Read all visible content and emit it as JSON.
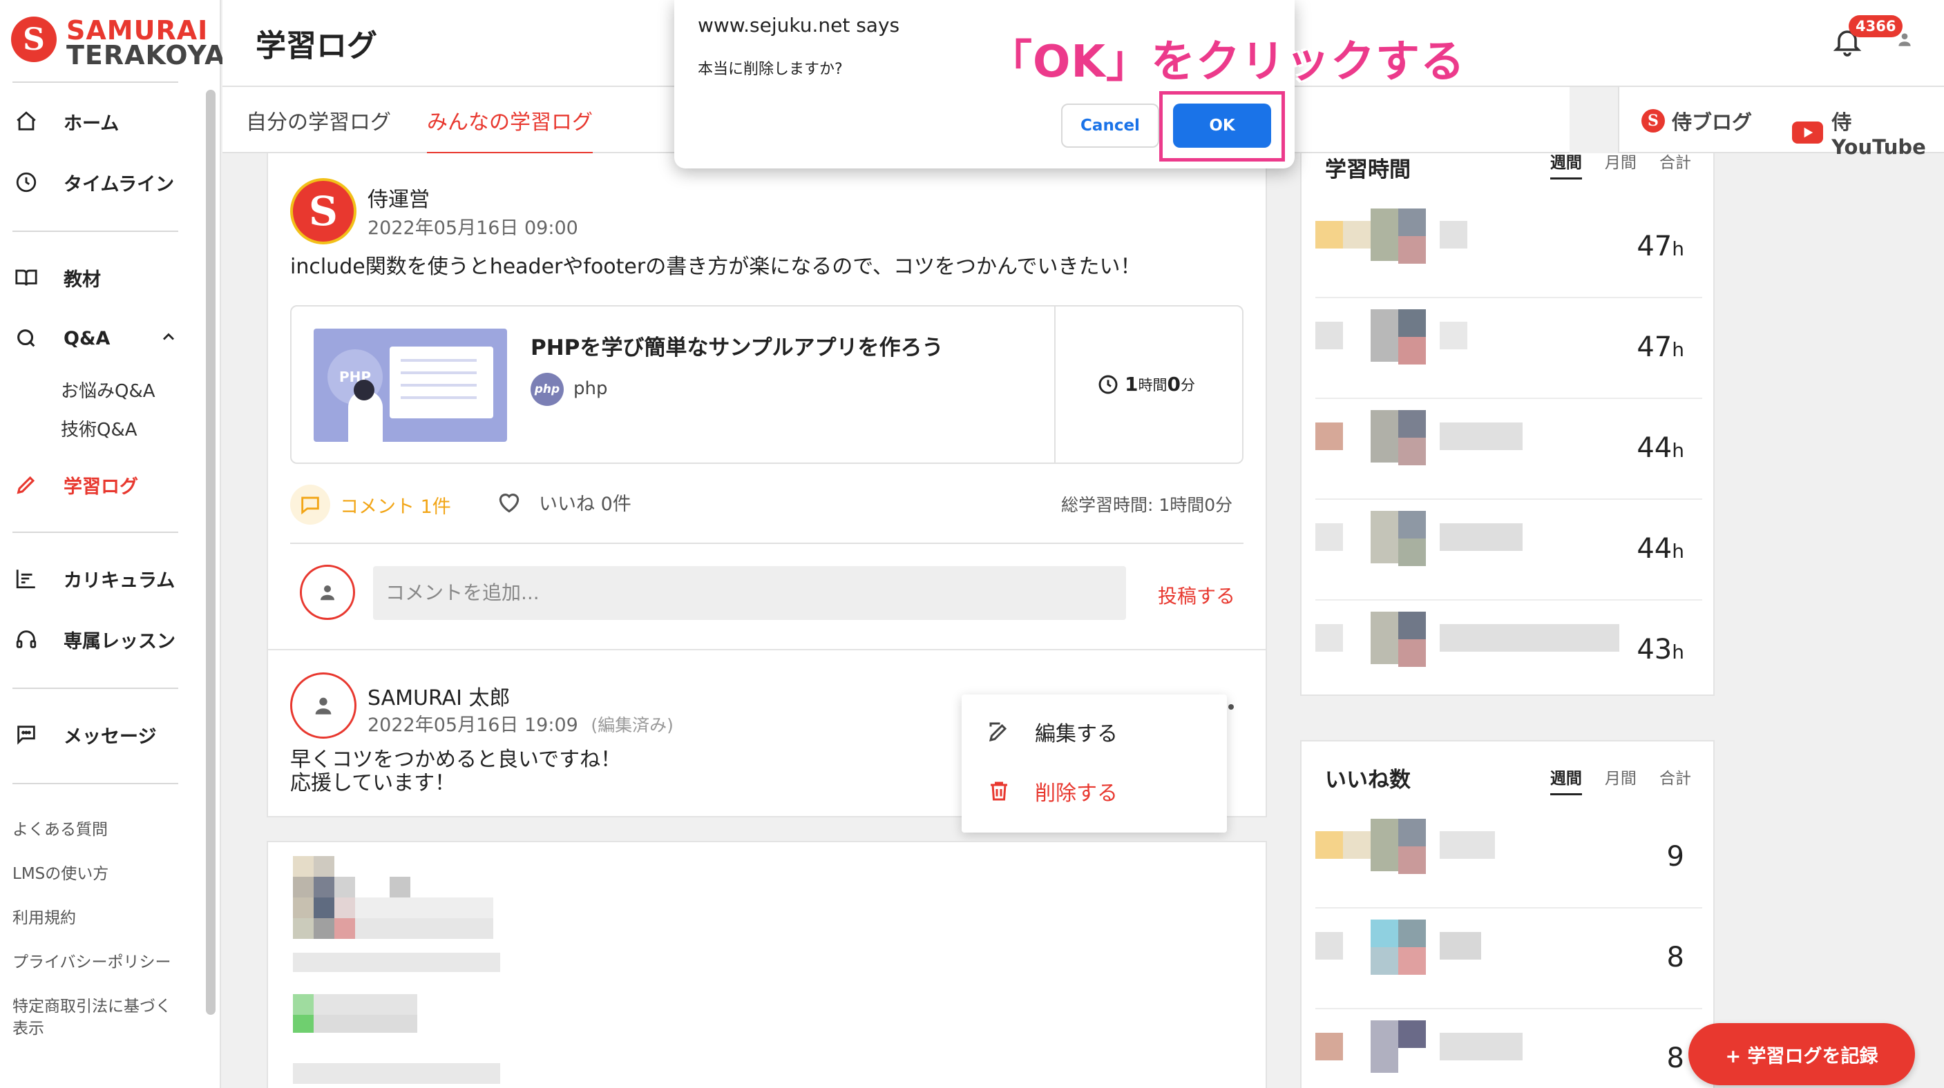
{
  "brand": {
    "line1": "SAMURAI",
    "line2": "TERAKOYA",
    "color": "#e8382f"
  },
  "sidebar": {
    "items": [
      {
        "label": "ホーム",
        "icon": "home-icon"
      },
      {
        "label": "タイムライン",
        "icon": "clock-icon"
      },
      {
        "label": "教材",
        "icon": "book-icon"
      },
      {
        "label": "Q&A",
        "icon": "qa-icon"
      },
      {
        "label": "学習ログ",
        "icon": "pencil-icon"
      },
      {
        "label": "カリキュラム",
        "icon": "chart-icon"
      },
      {
        "label": "専属レッスン",
        "icon": "headset-icon"
      },
      {
        "label": "メッセージ",
        "icon": "message-icon"
      }
    ],
    "qa_sub": [
      "お悩みQ&A",
      "技術Q&A"
    ],
    "footer_links": [
      "よくある質問",
      "LMSの使い方",
      "利用規約",
      "プライバシーポリシー",
      "特定商取引法に基づく表示"
    ]
  },
  "header": {
    "title": "学習ログ",
    "notification_count": "4366"
  },
  "tabs": [
    {
      "label": "自分の学習ログ",
      "active": false
    },
    {
      "label": "みんなの学習ログ",
      "active": true
    }
  ],
  "external_links": [
    {
      "label": "侍ブログ"
    },
    {
      "label": "侍YouTube"
    }
  ],
  "post": {
    "author": "侍運営",
    "date": "2022年05月16日 09:00",
    "text": "include関数を使うとheaderやfooterの書き方が楽になるので、コツをつかんでいきたい！",
    "material": {
      "thumb_label": "PHP",
      "title": "PHPを学び簡単なサンプルアプリを作ろう",
      "tag_icon": "php",
      "tag": "php",
      "time_hours": "1",
      "time_hours_unit": "時間",
      "time_minutes": "0",
      "time_minutes_unit": "分"
    },
    "comment_count_label": "コメント 1件",
    "like_label": "いいね 0件",
    "total_time": "総学習時間: 1時間0分",
    "comment_placeholder": "コメントを追加...",
    "post_button": "投稿する"
  },
  "comment": {
    "author": "SAMURAI 太郎",
    "date": "2022年05月16日 19:09",
    "edited": "(編集済み)",
    "line1": "早くコツをつかめると良いですね！",
    "line2": "応援しています！"
  },
  "context_menu": {
    "edit": "編集する",
    "delete": "削除する"
  },
  "ranking_time": {
    "title": "学習時間",
    "tabs": [
      "週間",
      "月間",
      "合計"
    ],
    "values": [
      "47",
      "47",
      "44",
      "44",
      "43"
    ],
    "unit": "h"
  },
  "ranking_likes": {
    "title": "いいね数",
    "tabs": [
      "週間",
      "月間",
      "合計"
    ],
    "values": [
      "9",
      "8",
      "8"
    ]
  },
  "fab": {
    "label": "+ 学習ログを記録"
  },
  "dialog": {
    "origin": "www.sejuku.net says",
    "message": "本当に削除しますか?",
    "cancel": "Cancel",
    "ok": "OK"
  },
  "annotation": {
    "text": "「OK」をクリックする",
    "color": "#ec3a8b"
  }
}
